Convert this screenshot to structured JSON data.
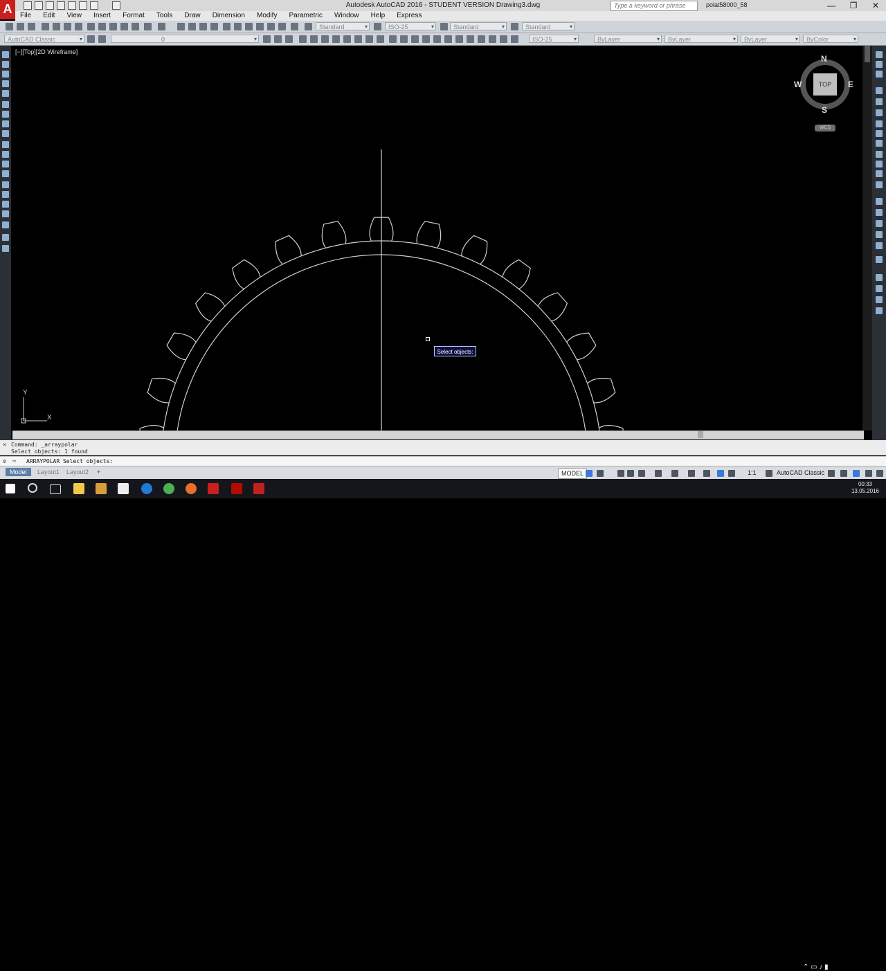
{
  "window": {
    "title": "Autodesk AutoCAD 2016 - STUDENT VERSION    Drawing3.dwg",
    "search_placeholder": "Type a keyword or phrase",
    "user": "polat58000_58",
    "minimize": "—",
    "restore": "❐",
    "close": "✕"
  },
  "app_logo": "A",
  "menu": [
    "File",
    "Edit",
    "View",
    "Insert",
    "Format",
    "Tools",
    "Draw",
    "Dimension",
    "Modify",
    "Parametric",
    "Window",
    "Help",
    "Express"
  ],
  "toolbar1": {
    "text_style": "Standard",
    "dim_style": "ISO-25",
    "table_style": "Standard",
    "mleader_style": "Standard"
  },
  "toolbar2": {
    "workspace": "AutoCAD Classic",
    "layer": "0",
    "dim_scale_style": "ISO-25",
    "color": "ByLayer",
    "linetype": "ByLayer",
    "lineweight": "ByLayer",
    "plotstyle": "ByColor"
  },
  "viewport": {
    "label": "[−][Top][2D Wireframe]",
    "tooltip": "Select objects:"
  },
  "viewcube": {
    "top_face": "TOP",
    "north": "N",
    "south": "S",
    "east": "E",
    "west": "W",
    "ucs": "WCS"
  },
  "ucs_icon": {
    "y_label": "Y",
    "x_label": "X"
  },
  "command": {
    "history": [
      "Command: _arraypolar",
      "Select objects: 1 found"
    ],
    "prompt": "ARRAYPOLAR Select objects:"
  },
  "tabs": [
    "Model",
    "Layout1",
    "Layout2"
  ],
  "add_tab": "+",
  "status": {
    "space": "MODEL",
    "scale": "1:1",
    "workspace": "AutoCAD Classic"
  },
  "clock": {
    "time": "00:33",
    "date": "13.05.2016"
  },
  "gear": {
    "teeth": 30,
    "color": "#d0d0d0"
  }
}
